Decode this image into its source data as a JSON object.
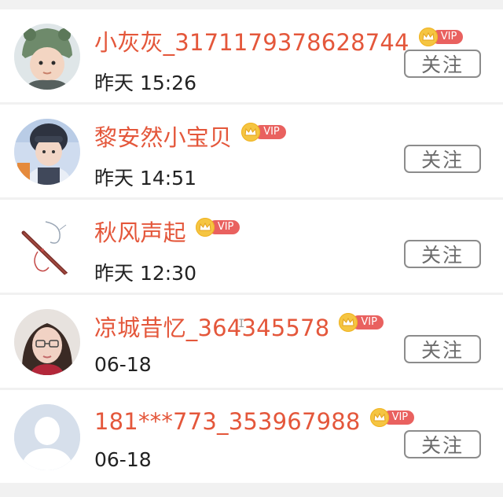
{
  "follow_label": "关注",
  "vip_label": "VIP",
  "users": [
    {
      "name": "小灰灰_3171179378628744",
      "time": "昨天 15:26",
      "avatar": "baby-in-green-hat-avatar"
    },
    {
      "name": "黎安然小宝贝",
      "time": "昨天 14:51",
      "avatar": "child-with-helmet-avatar"
    },
    {
      "name": "秋风声起",
      "time": "昨天 12:30",
      "avatar": "flute-sketch-avatar"
    },
    {
      "name": "凉城昔忆_364345578",
      "time": "06-18",
      "avatar": "girl-with-glasses-avatar"
    },
    {
      "name": "181***773_353967988",
      "time": "06-18",
      "avatar": "default-user-avatar"
    }
  ],
  "colors": {
    "name": "#e4573b",
    "vip_tag": "#e9615f",
    "crown": "#f5c542",
    "button_border": "#8c8c8c",
    "separator": "#f1f1f1"
  }
}
